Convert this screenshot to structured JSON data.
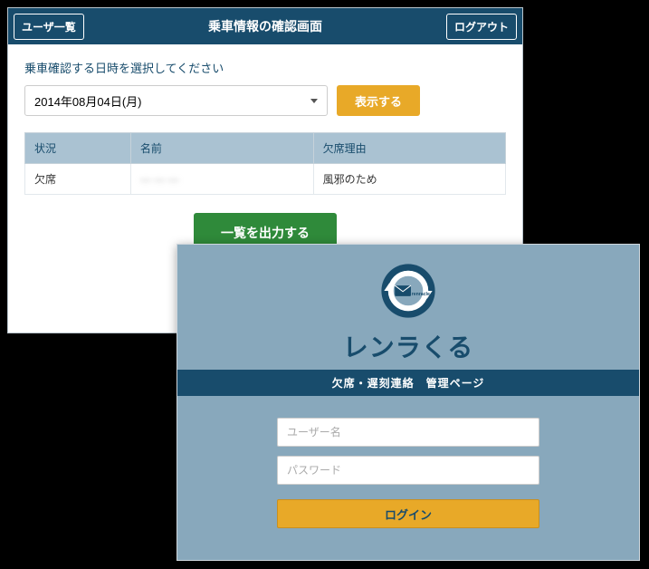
{
  "panel1": {
    "header": {
      "user_list_btn": "ユーザ一覧",
      "title": "乗車情報の確認画面",
      "logout_btn": "ログアウト"
    },
    "instruction": "乗車確認する日時を選択してください",
    "date_selected": "2014年08月04日(月)",
    "show_btn": "表示する",
    "table": {
      "headers": {
        "status": "状況",
        "name": "名前",
        "reason": "欠席理由"
      },
      "row": {
        "status": "欠席",
        "name": "― ― ―",
        "reason": "風邪のため"
      }
    },
    "export_btn": "一覧を出力する"
  },
  "panel2": {
    "logo_brand": "renracle",
    "logo_text": "レンラくる",
    "subbar": "欠席・遅刻連絡　管理ページ",
    "username_placeholder": "ユーザー名",
    "password_placeholder": "パスワード",
    "login_btn": "ログイン"
  },
  "colors": {
    "primary": "#184c6c",
    "accent": "#e8a928",
    "success": "#2f8a3a",
    "panel2_bg": "#88a8bc"
  }
}
